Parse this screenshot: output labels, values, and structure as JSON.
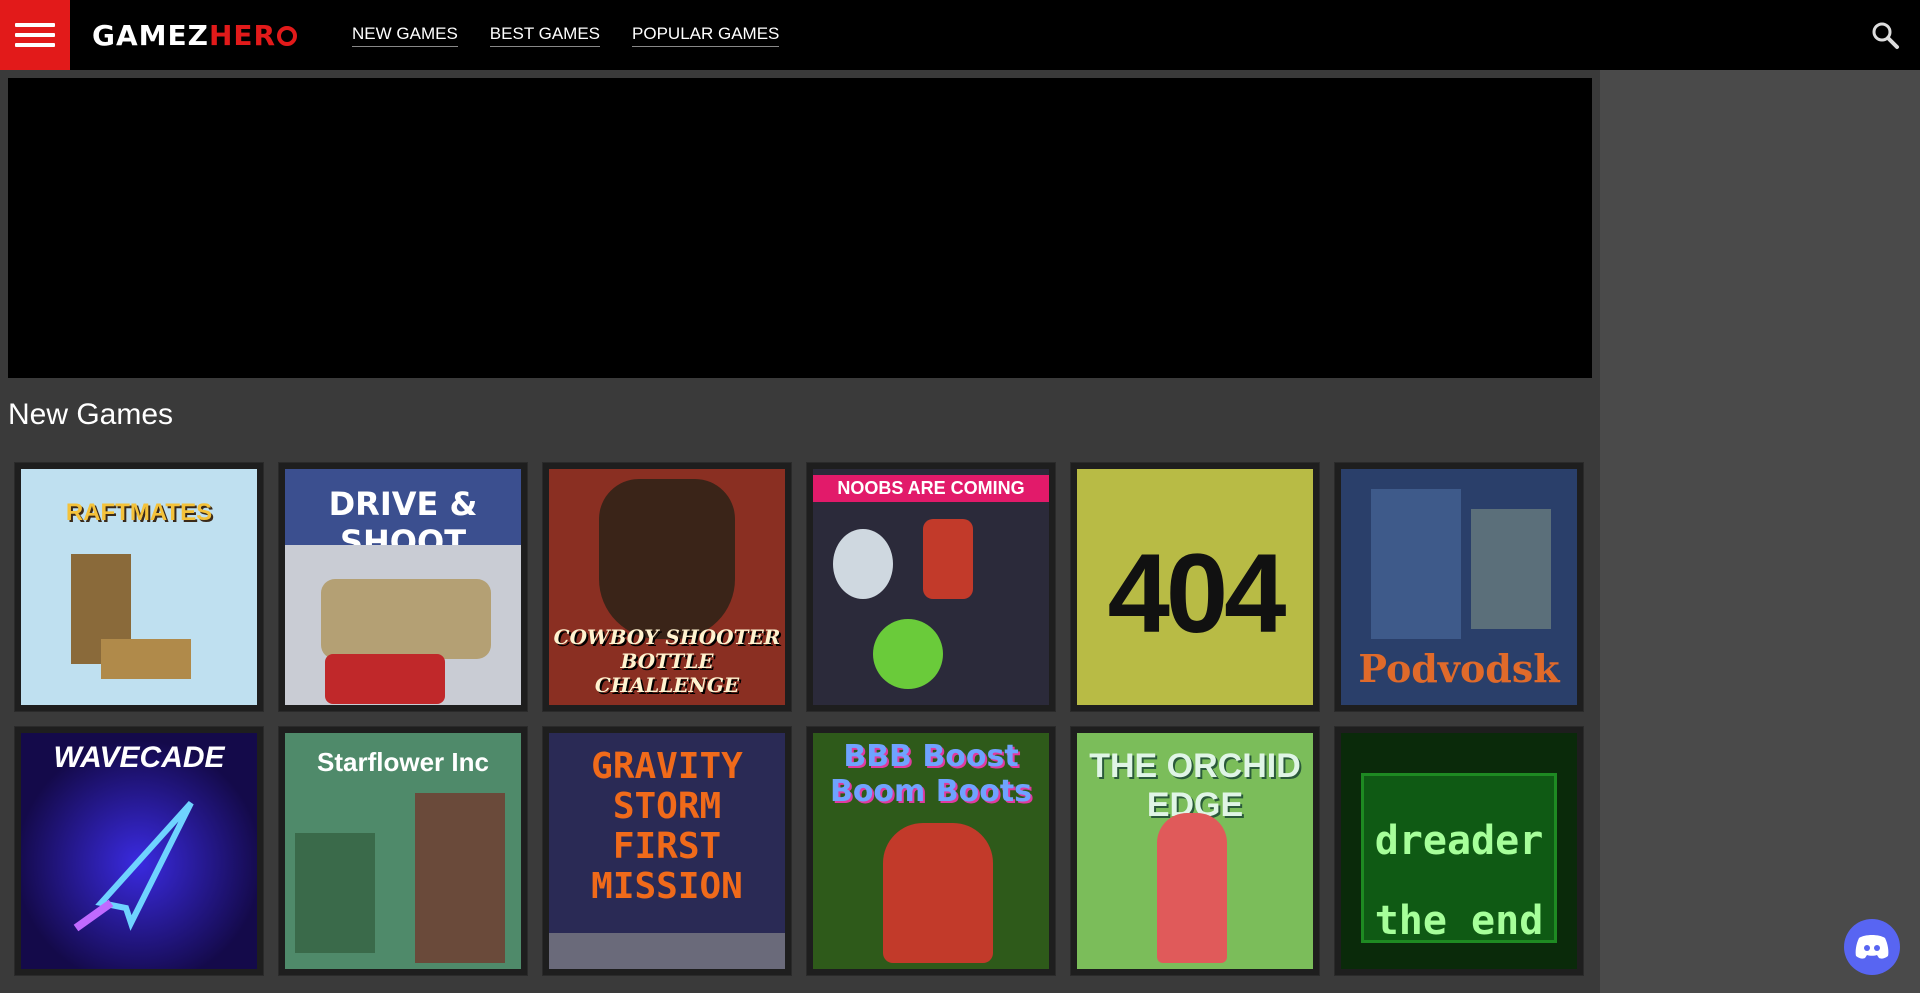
{
  "header": {
    "logo_part1": "GAMEZ",
    "logo_part2": "HER",
    "nav": [
      {
        "label": "NEW GAMES"
      },
      {
        "label": "BEST GAMES"
      },
      {
        "label": "POPULAR GAMES"
      }
    ],
    "icons": {
      "menu": "hamburger-icon",
      "search": "search-icon"
    }
  },
  "main": {
    "section_title": "New Games",
    "games": [
      {
        "title": "RAFTMATES",
        "bg": "#bfe0f0"
      },
      {
        "title": "DRIVE & SHOOT",
        "bg": "#3b4f8f"
      },
      {
        "title": "COWBOY SHOOTER BOTTLE CHALLENGE",
        "bg": "#8a2f22"
      },
      {
        "title": "NOOBS ARE COMING",
        "bg": "#2b2a3a"
      },
      {
        "title": "404",
        "bg": "#b8bb45"
      },
      {
        "title": "Podvodsk",
        "bg": "#2a3f6a"
      },
      {
        "title": "WAVECADE",
        "bg": "#140a4a"
      },
      {
        "title": "Starflower Inc",
        "bg": "#4f8a6a"
      },
      {
        "title": "GRAVITY STORM FIRST MISSION",
        "bg": "#2a2a55"
      },
      {
        "title": "BBB Boost Boom Boots",
        "bg": "#2e5a1a"
      },
      {
        "title": "THE ORCHID EDGE",
        "bg": "#7bbd5a"
      },
      {
        "title": "dreader the end",
        "bg": "#0a2a0a"
      }
    ]
  },
  "colors": {
    "accent": "#e21a1a",
    "discord": "#5865f2"
  },
  "floating": {
    "discord_icon": "discord-icon"
  }
}
